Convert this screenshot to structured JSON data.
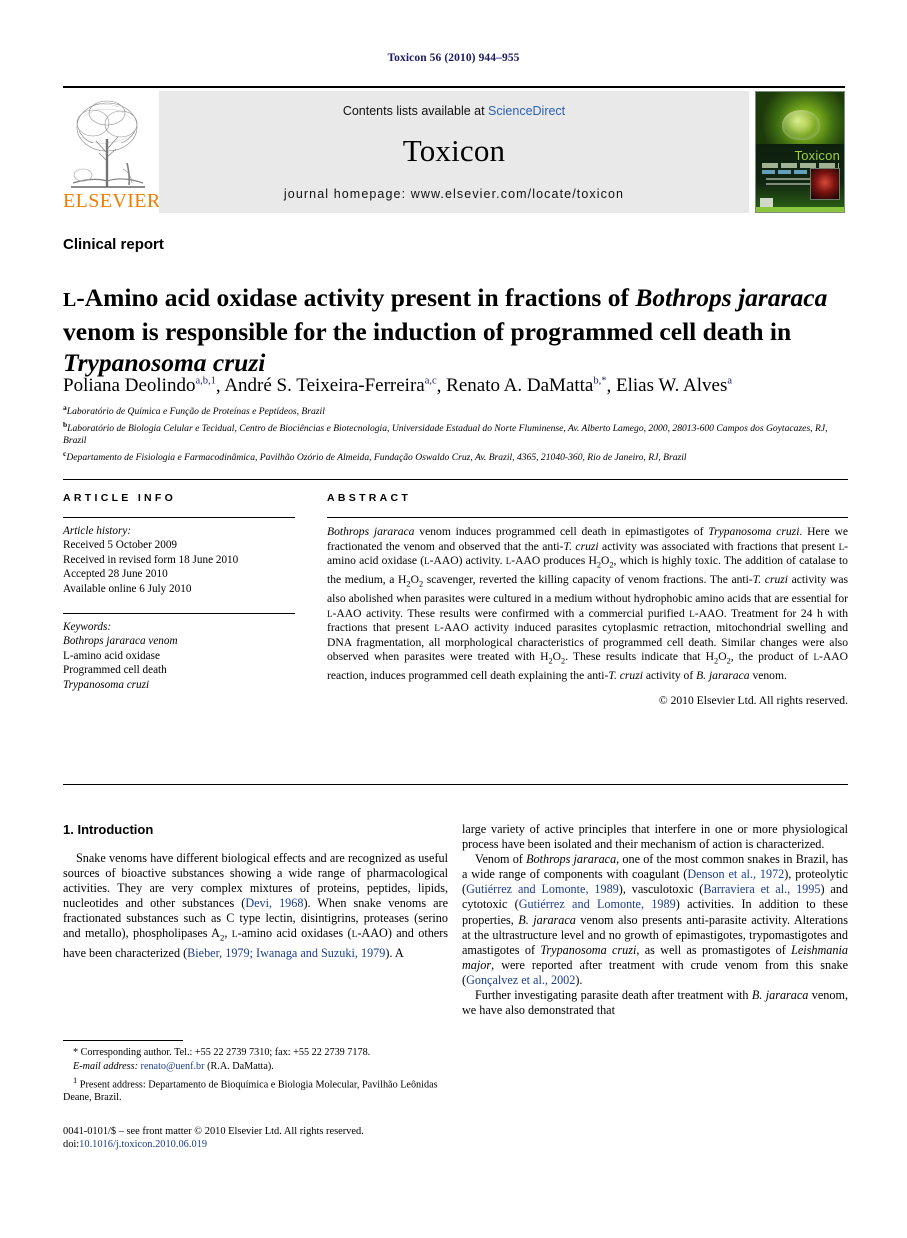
{
  "running_head": "Toxicon 56 (2010) 944–955",
  "masthead": {
    "publisher_logo_text": "ELSEVIER",
    "contents_prefix": "Contents lists available at ",
    "contents_link": "ScienceDirect",
    "journal_title": "Toxicon",
    "homepage": "journal homepage: www.elsevier.com/locate/toxicon",
    "cover_title": "Toxicon"
  },
  "article": {
    "type_label": "Clinical report",
    "title_line1_pre": "-Amino acid oxidase activity present in fractions of ",
    "title_smallcap": "L",
    "title_italic1": "Bothrops jararaca",
    "title_line2": "venom is responsible for the induction of programmed cell death in",
    "title_italic2": "Trypanosoma cruzi",
    "authors": [
      {
        "name": "Poliana Deolindo",
        "sup": "a,b,1",
        "sep": ", "
      },
      {
        "name": "André S. Teixeira-Ferreira",
        "sup": "a,c",
        "sep": ", "
      },
      {
        "name": "Renato A. DaMatta",
        "sup": "b,*",
        "sep": ", "
      },
      {
        "name": "Elias W. Alves",
        "sup": "a",
        "sep": ""
      }
    ],
    "affiliations": [
      {
        "marker": "a",
        "text": "Laboratório de Química e Função de Proteínas e Peptídeos, Brazil"
      },
      {
        "marker": "b",
        "text": "Laboratório de Biologia Celular e Tecidual, Centro de Biociências e Biotecnologia, Universidade Estadual do Norte Fluminense, Av. Alberto Lamego, 2000, 28013-600 Campos dos Goytacazes, RJ, Brazil"
      },
      {
        "marker": "c",
        "text": "Departamento de Fisiologia e Farmacodinâmica, Pavilhão Ozório de Almeida, Fundação Oswaldo Cruz, Av. Brazil, 4365, 21040-360, Rio de Janeiro, RJ, Brazil"
      }
    ]
  },
  "panel": {
    "info_header": "ARTICLE INFO",
    "abstract_header": "ABSTRACT",
    "history_label": "Article history:",
    "history": [
      "Received 5 October 2009",
      "Received in revised form 18 June 2010",
      "Accepted 28 June 2010",
      "Available online 6 July 2010"
    ],
    "keywords_label": "Keywords:",
    "keywords": [
      "Bothrops jararaca venom",
      "L-amino acid oxidase",
      "Programmed cell death",
      "Trypanosoma cruzi"
    ],
    "copyright": "© 2010 Elsevier Ltd. All rights reserved."
  },
  "body": {
    "section_heading": "1. Introduction",
    "left_paragraphs": [
      "Snake venoms have different biological effects and are recognized as useful sources of bioactive substances showing a wide range of pharmacological activities. They are very complex mixtures of proteins, peptides, lipids, nucleotides and other substances (Devi, 1968). When snake venoms are fractionated substances such as C type lectin, disintigrins, proteases (serino and metallo), phospholipases A2, L-amino acid oxidases (L-AAO) and others have been characterized (Bieber, 1979; Iwanaga and Suzuki, 1979). A"
    ],
    "right_paragraphs": [
      "large variety of active principles that interfere in one or more physiological process have been isolated and their mechanism of action is characterized.",
      "Venom of Bothrops jararaca, one of the most common snakes in Brazil, has a wide range of components with coagulant (Denson et al., 1972), proteolytic (Gutiérrez and Lomonte, 1989), vasculotoxic (Barraviera et al., 1995) and cytotoxic (Gutiérrez and Lomonte, 1989) activities. In addition to these properties, B. jararaca venom also presents anti-parasite activity. Alterations at the ultrastructure level and no growth of epimastigotes, trypomastigotes and amastigotes of Trypanosoma cruzi, as well as promastigotes of Leishmania major, were reported after treatment with crude venom from this snake (Gonçalvez et al., 2002).",
      "Further investigating parasite death after treatment with B. jararaca venom, we have also demonstrated that"
    ]
  },
  "footnotes": {
    "corresponding": "Corresponding author. Tel.: +55 22 2739 7310; fax: +55 22 2739 7178.",
    "email_label": "E-mail address:",
    "email": "renato@uenf.br",
    "email_owner": "(R.A. DaMatta).",
    "present_address": "Present address: Departamento de Bioquímica e Biologia Molecular, Pavilhão Leônidas Deane, Brazil."
  },
  "imprint": {
    "issn_line": "0041-0101/$ – see front matter © 2010 Elsevier Ltd. All rights reserved.",
    "doi_label": "doi:",
    "doi": "10.1016/j.toxicon.2010.06.019"
  },
  "colors": {
    "running_head": "#1a1a66",
    "link": "#2b5fbb",
    "reference": "#1a3e8c",
    "elsevier_orange": "#ef7d00",
    "banner_gray": "#e9e9e9"
  }
}
